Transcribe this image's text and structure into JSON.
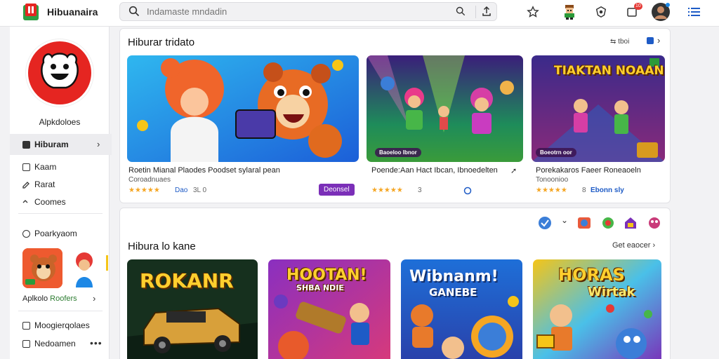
{
  "app": {
    "brand": "Hibuanaira"
  },
  "search": {
    "placeholder": "Indamaste mndadin"
  },
  "sidebar": {
    "profile_name": "Alpkdoloes",
    "active_item": "Hiburam",
    "items": [
      {
        "label": "Kaam"
      },
      {
        "label": "Rarat"
      },
      {
        "label": "Coomes"
      },
      {
        "label": "Poarkyaom"
      }
    ],
    "link": {
      "pre": "Aplkolo",
      "highlight": "Roofers"
    },
    "bottom_items": [
      {
        "label": "Moogierqolaes"
      },
      {
        "label": "Nedoamen"
      }
    ]
  },
  "section1": {
    "title": "Hiburar tridato",
    "header_action": "tboi",
    "cards": [
      {
        "title": "Roetin Mianal Plaodes Poodset sylaral pean",
        "sub": "Coroadnuaes",
        "rating": "Dao",
        "count": "3L 0",
        "button": "Deonsel"
      },
      {
        "title": "Poende:Aan Hact Ibcan, Ibnoedelten",
        "sub": "",
        "rating": "",
        "count": "3",
        "overlay": "Baoeloo Ibnor"
      },
      {
        "title": "Porekakaros Faeer Roneaoeln",
        "sub": "Tonoonioo",
        "rating": "",
        "count": "8",
        "tag": "Ebonn sly",
        "banner": "TIAKTAN NOAAN",
        "overlay": "Boeotrn oor"
      }
    ]
  },
  "section2": {
    "title": "Hibura lo kane",
    "header_action": "Get eaocer",
    "cards": [
      {
        "banner": "ROKANR"
      },
      {
        "banner": "HOOTAN!",
        "sub_banner": "SHBA NDIE"
      },
      {
        "banner": "Wibnanm!",
        "sub_banner": "GANEBE"
      },
      {
        "banner": "HORAS",
        "sub_banner": "Wirtak"
      }
    ]
  },
  "icons": {
    "logo": "game-logo-icon",
    "search": "search-icon",
    "upload": "upload-icon",
    "star": "star-icon",
    "character": "character-icon",
    "shield": "shield-icon",
    "notifications": "notification-icon",
    "notification_badge": "10",
    "menu": "menu-icon"
  },
  "colors": {
    "accent": "#7b2fb8",
    "star": "#f5a623",
    "logo_red": "#e52521",
    "link_green": "#2e7d32"
  }
}
